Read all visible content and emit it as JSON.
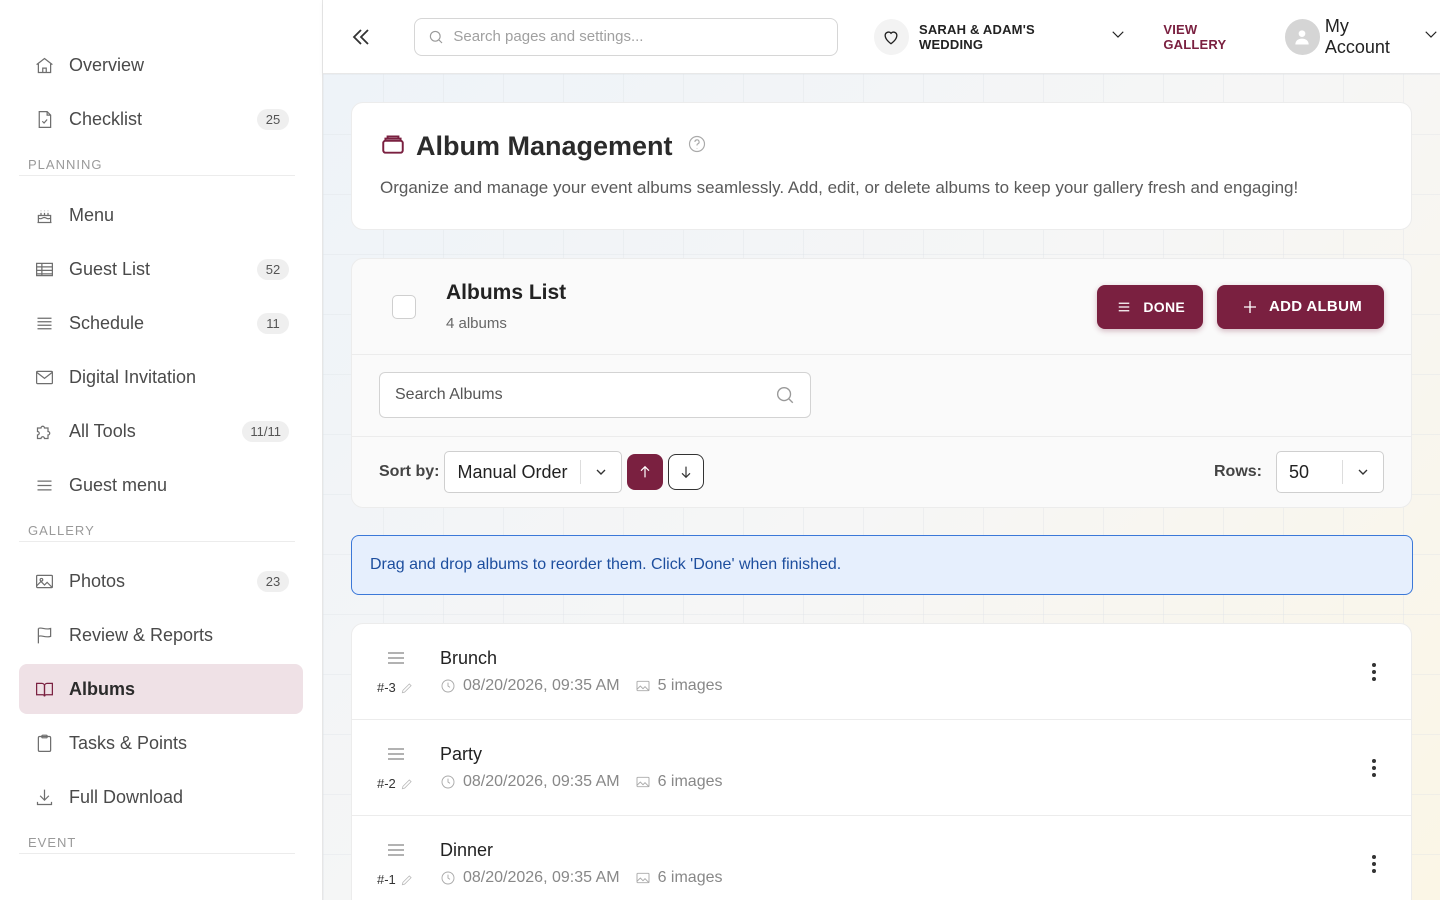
{
  "sidebar": {
    "top_items": [
      {
        "label": "Overview",
        "icon": "home-icon"
      },
      {
        "label": "Checklist",
        "icon": "checklist-icon",
        "badge": "25"
      }
    ],
    "sections": [
      {
        "title": "PLANNING",
        "items": [
          {
            "label": "Menu",
            "icon": "cake-icon"
          },
          {
            "label": "Guest List",
            "icon": "table-icon",
            "badge": "52"
          },
          {
            "label": "Schedule",
            "icon": "schedule-icon",
            "badge": "11"
          },
          {
            "label": "Digital Invitation",
            "icon": "envelope-icon"
          },
          {
            "label": "All Tools",
            "icon": "puzzle-icon",
            "badge": "11/11"
          },
          {
            "label": "Guest menu",
            "icon": "menu-lines-icon"
          }
        ]
      },
      {
        "title": "GALLERY",
        "items": [
          {
            "label": "Photos",
            "icon": "image-icon",
            "badge": "23"
          },
          {
            "label": "Review & Reports",
            "icon": "flag-icon"
          },
          {
            "label": "Albums",
            "icon": "book-icon",
            "active": true
          },
          {
            "label": "Tasks & Points",
            "icon": "clipboard-icon"
          },
          {
            "label": "Full Download",
            "icon": "download-icon"
          }
        ]
      },
      {
        "title": "EVENT",
        "items": []
      }
    ]
  },
  "topbar": {
    "search_placeholder": "Search pages and settings...",
    "event_name": "SARAH & ADAM'S WEDDING",
    "view_gallery": "VIEW GALLERY",
    "account_label": "My Account"
  },
  "header": {
    "title": "Album Management",
    "description": "Organize and manage your event albums seamlessly. Add, edit, or delete albums to keep your gallery fresh and engaging!"
  },
  "list": {
    "title": "Albums List",
    "count_label": "4 albums",
    "done_label": "DONE",
    "add_label": "ADD ALBUM",
    "search_placeholder": "Search Albums",
    "sort_label": "Sort by:",
    "sort_value": "Manual Order",
    "rows_label": "Rows:",
    "rows_value": "50"
  },
  "banner": {
    "text": "Drag and drop albums to reorder them. Click 'Done' when finished."
  },
  "albums": [
    {
      "order": "#-3",
      "name": "Brunch",
      "date": "08/20/2026, 09:35 AM",
      "images": "5 images"
    },
    {
      "order": "#-2",
      "name": "Party",
      "date": "08/20/2026, 09:35 AM",
      "images": "6 images"
    },
    {
      "order": "#-1",
      "name": "Dinner",
      "date": "08/20/2026, 09:35 AM",
      "images": "6 images"
    }
  ],
  "colors": {
    "accent": "#7a2040",
    "active_bg": "#efe1e6",
    "info_border": "#3b78d8",
    "info_bg": "#e6effd"
  }
}
